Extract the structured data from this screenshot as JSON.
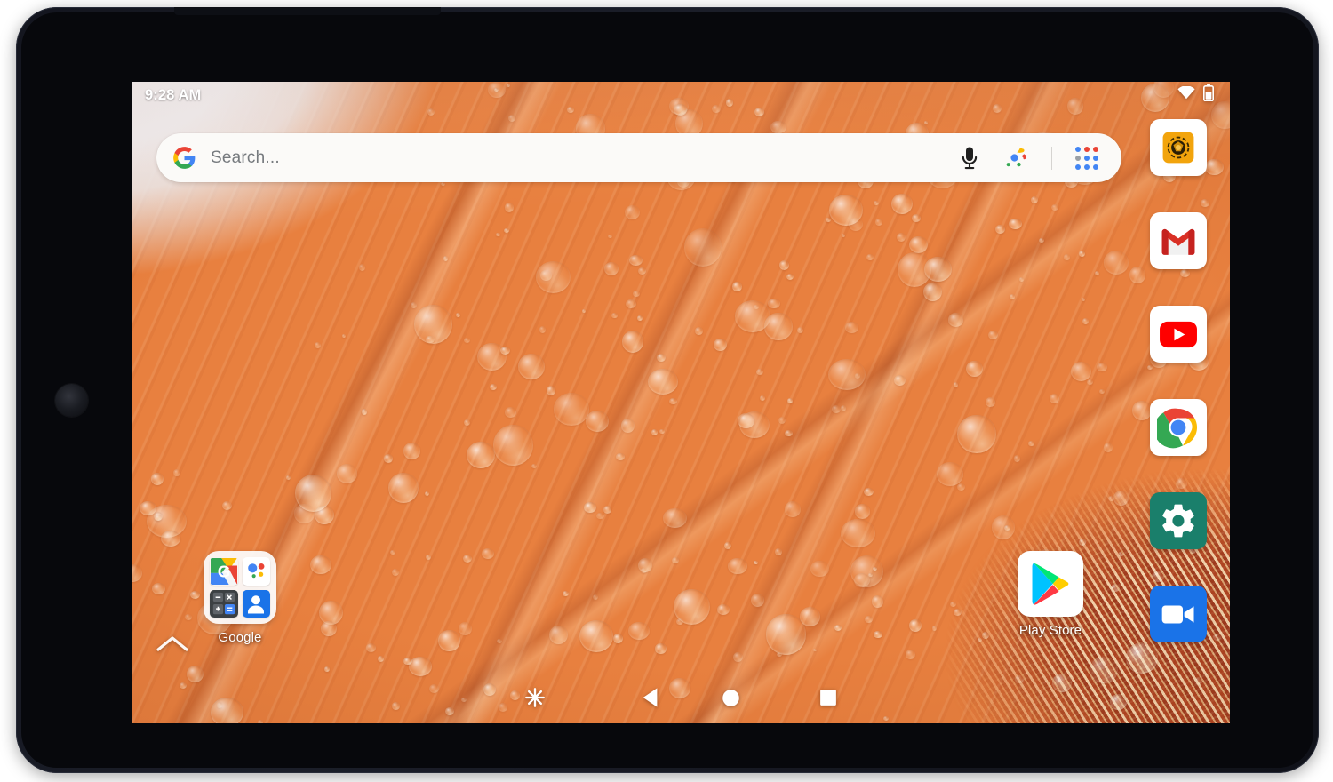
{
  "device": {
    "type": "android-tablet",
    "bezel_color": "#14161f",
    "screen_background": "#e8803f"
  },
  "status_bar": {
    "clock": "9:28 AM",
    "icons": [
      {
        "name": "wifi-icon",
        "label": "Wi-Fi"
      },
      {
        "name": "battery-icon",
        "label": "Battery"
      }
    ]
  },
  "search": {
    "placeholder": "Search...",
    "google_logo_name": "google-g-logo",
    "mic_name": "microphone-icon",
    "lens_name": "google-lens-icon",
    "apps_grid_name": "google-apps-grid-icon",
    "colors": {
      "google_blue": "#4285F4",
      "google_red": "#EA4335",
      "google_yellow": "#FBBC05",
      "google_green": "#34A853"
    }
  },
  "right_dock": {
    "apps": [
      {
        "id": "camera",
        "label": "Camera",
        "icon": "camera-icon",
        "color": "#F2A40C"
      },
      {
        "id": "gmail",
        "label": "Gmail",
        "icon": "gmail-icon",
        "color": "#D93025"
      },
      {
        "id": "youtube",
        "label": "YouTube",
        "icon": "youtube-icon",
        "color": "#FF0000"
      },
      {
        "id": "chrome",
        "label": "Chrome",
        "icon": "chrome-icon",
        "color": "#4285F4"
      },
      {
        "id": "settings",
        "label": "Settings",
        "icon": "settings-gear-icon",
        "color": "#1A7F6B"
      },
      {
        "id": "duo",
        "label": "Duo",
        "icon": "video-camera-icon",
        "color": "#1A73E8"
      }
    ]
  },
  "home_screen": {
    "folder": {
      "label": "Google",
      "apps": [
        {
          "id": "google",
          "label": "Google",
          "icon": "google-search-icon"
        },
        {
          "id": "assistant",
          "label": "Assistant",
          "icon": "google-assistant-icon"
        },
        {
          "id": "calculator",
          "label": "Calculator",
          "icon": "calculator-icon"
        },
        {
          "id": "contacts",
          "label": "Contacts",
          "icon": "contacts-icon"
        }
      ]
    },
    "play_store": {
      "label": "Play Store",
      "icon": "play-store-icon"
    },
    "drawer_handle": {
      "icon": "chevron-up-icon",
      "label": "Open app drawer"
    }
  },
  "nav_bar": {
    "buttons": [
      {
        "id": "assistant",
        "label": "Assistant",
        "icon": "assistant-star-icon"
      },
      {
        "id": "back",
        "label": "Back",
        "icon": "back-triangle-icon"
      },
      {
        "id": "home",
        "label": "Home",
        "icon": "home-circle-icon"
      },
      {
        "id": "recents",
        "label": "Recents",
        "icon": "recents-square-icon"
      }
    ]
  },
  "wallpaper": {
    "description": "Orange gerbera daisy petals covered in water droplets",
    "dominant_colors": [
      "#e8764a",
      "#f3bd4e",
      "#c2542c",
      "#f2f2f4"
    ]
  }
}
